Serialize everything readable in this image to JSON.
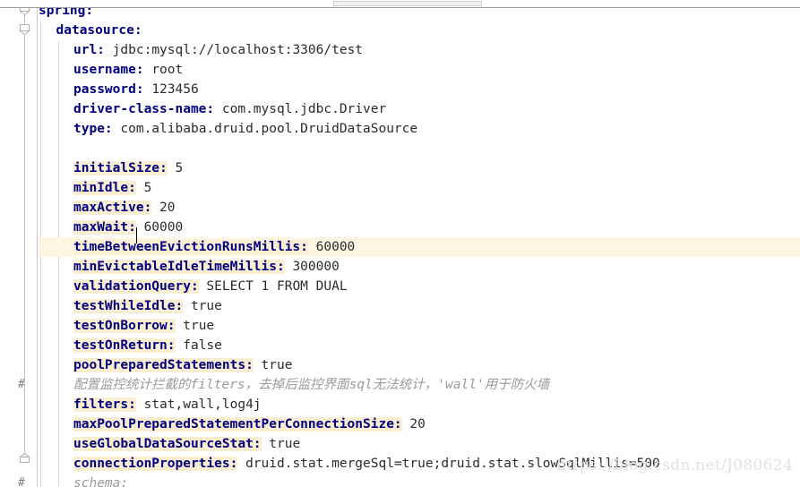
{
  "app": {
    "kind": "ide-yaml-editor",
    "file_kind": "application.yml"
  },
  "scrollbar": {
    "name": "horizontal-scrollbar"
  },
  "gutter": {
    "fold_markers": [
      {
        "name": "fold-marker-spring",
        "state": "expanded",
        "glyph": "▽"
      },
      {
        "name": "fold-marker-datasource",
        "state": "expanded",
        "glyph": "▽"
      },
      {
        "name": "fold-marker-close",
        "state": "block-end",
        "glyph": "△"
      }
    ],
    "comment_marks": [
      "#",
      "#"
    ]
  },
  "caret": {
    "line_index": 11,
    "after_text": "timeBetw"
  },
  "watermark": {
    "text": "https://blog.csdn.net/J080624"
  },
  "colors": {
    "key": "#000080",
    "value": "#2b2b2b",
    "comment": "#9a9a9a",
    "key_highlight": "#faeed2",
    "current_line": "#fdf6e3",
    "gutter_border": "#c8c8c8"
  },
  "code": {
    "lines": [
      {
        "indent": 0,
        "key": "spring",
        "value": "",
        "key_highlight": false,
        "type": "key"
      },
      {
        "indent": 1,
        "key": "datasource",
        "value": "",
        "key_highlight": false,
        "type": "key"
      },
      {
        "indent": 2,
        "key": "url",
        "value": "jdbc:mysql://localhost:3306/test",
        "key_highlight": false,
        "type": "pair"
      },
      {
        "indent": 2,
        "key": "username",
        "value": "root",
        "key_highlight": false,
        "type": "pair"
      },
      {
        "indent": 2,
        "key": "password",
        "value": "123456",
        "key_highlight": false,
        "type": "pair"
      },
      {
        "indent": 2,
        "key": "driver-class-name",
        "value": "com.mysql.jdbc.Driver",
        "key_highlight": false,
        "type": "pair"
      },
      {
        "indent": 2,
        "key": "type",
        "value": "com.alibaba.druid.pool.DruidDataSource",
        "key_highlight": false,
        "type": "pair"
      },
      {
        "indent": 2,
        "key": "",
        "value": "",
        "key_highlight": false,
        "type": "blank"
      },
      {
        "indent": 2,
        "key": "initialSize",
        "value": "5",
        "key_highlight": true,
        "type": "pair"
      },
      {
        "indent": 2,
        "key": "minIdle",
        "value": "5",
        "key_highlight": true,
        "type": "pair"
      },
      {
        "indent": 2,
        "key": "maxActive",
        "value": "20",
        "key_highlight": true,
        "type": "pair"
      },
      {
        "indent": 2,
        "key": "maxWait",
        "value": "60000",
        "key_highlight": true,
        "type": "pair"
      },
      {
        "indent": 2,
        "key": "timeBetweenEvictionRunsMillis",
        "value": "60000",
        "key_highlight": true,
        "type": "pair",
        "current": true
      },
      {
        "indent": 2,
        "key": "minEvictableIdleTimeMillis",
        "value": "300000",
        "key_highlight": true,
        "type": "pair"
      },
      {
        "indent": 2,
        "key": "validationQuery",
        "value": "SELECT 1 FROM DUAL",
        "key_highlight": true,
        "type": "pair"
      },
      {
        "indent": 2,
        "key": "testWhileIdle",
        "value": "true",
        "key_highlight": true,
        "type": "pair"
      },
      {
        "indent": 2,
        "key": "testOnBorrow",
        "value": "true",
        "key_highlight": true,
        "type": "pair"
      },
      {
        "indent": 2,
        "key": "testOnReturn",
        "value": "false",
        "key_highlight": true,
        "type": "pair"
      },
      {
        "indent": 2,
        "key": "poolPreparedStatements",
        "value": "true",
        "key_highlight": true,
        "type": "pair"
      },
      {
        "indent": 2,
        "key": "",
        "value": "",
        "key_highlight": false,
        "type": "comment",
        "comment": "配置监控统计拦截的filters，去掉后监控界面sql无法统计，'wall'用于防火墙"
      },
      {
        "indent": 2,
        "key": "filters",
        "value": "stat,wall,log4j",
        "key_highlight": true,
        "type": "pair"
      },
      {
        "indent": 2,
        "key": "maxPoolPreparedStatementPerConnectionSize",
        "value": "20",
        "key_highlight": true,
        "type": "pair"
      },
      {
        "indent": 2,
        "key": "useGlobalDataSourceStat",
        "value": "true",
        "key_highlight": true,
        "type": "pair"
      },
      {
        "indent": 2,
        "key": "connectionProperties",
        "value": "druid.stat.mergeSql=true;druid.stat.slowSqlMillis=500",
        "key_highlight": true,
        "type": "pair"
      },
      {
        "indent": 2,
        "key": "",
        "value": "",
        "key_highlight": false,
        "type": "comment",
        "comment": "schema:"
      }
    ]
  }
}
